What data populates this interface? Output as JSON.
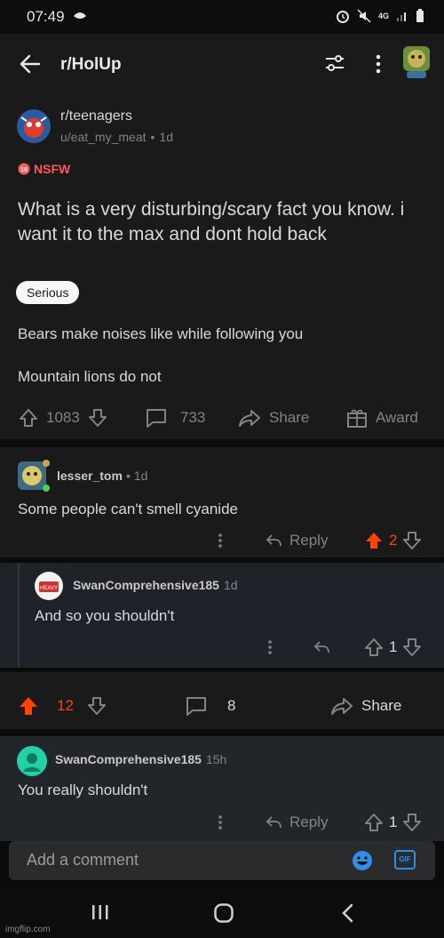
{
  "status": {
    "time": "07:49",
    "network": "4G"
  },
  "appbar": {
    "title": "r/HolUp"
  },
  "post": {
    "subreddit": "r/teenagers",
    "author": "u/eat_my_meat",
    "age": "1d",
    "nsfw_label": "NSFW",
    "title": "What is a very disturbing/scary fact you know. i want it to the max and dont hold back",
    "flair": "Serious",
    "body_line1": "Bears make noises like while following you",
    "body_line2": "Mountain lions do not",
    "upvotes": "1083",
    "comments": "733",
    "share_label": "Share",
    "award_label": "Award"
  },
  "comments": [
    {
      "user": "lesser_tom",
      "age": "1d",
      "text": "Some people can't smell cyanide",
      "reply_label": "Reply",
      "votes": "2"
    },
    {
      "user": "SwanComprehensive185",
      "age": "1d",
      "text": "And so you shouldn't",
      "votes": "1"
    },
    {
      "user": "SwanComprehensive185",
      "age": "15h",
      "text": "You really shouldn't",
      "reply_label": "Reply",
      "votes": "1"
    }
  ],
  "post_bar": {
    "votes": "12",
    "comments": "8",
    "share_label": "Share"
  },
  "add_comment": {
    "placeholder": "Add a comment",
    "gif_label": "GIF"
  },
  "watermark": "imgflip.com",
  "colors": {
    "upvote_orange": "#ff4500",
    "background": "#1a1a1b"
  }
}
